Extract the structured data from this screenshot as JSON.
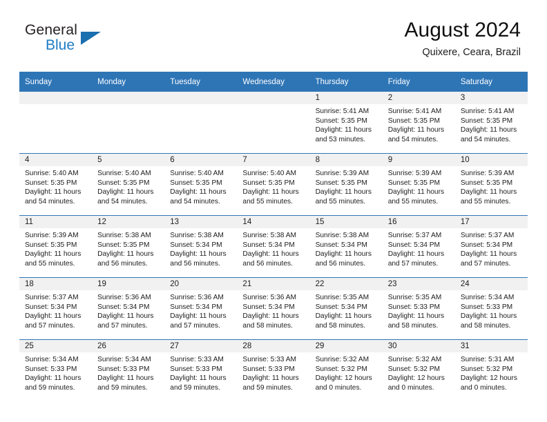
{
  "brand": {
    "name_part1": "General",
    "name_part2": "Blue"
  },
  "header": {
    "title": "August 2024",
    "subtitle": "Quixere, Ceara, Brazil"
  },
  "colors": {
    "header_blue": "#2e75b6",
    "brand_blue": "#1d7cc4",
    "daynum_band": "#f1f1f1"
  },
  "weekdays": [
    "Sunday",
    "Monday",
    "Tuesday",
    "Wednesday",
    "Thursday",
    "Friday",
    "Saturday"
  ],
  "weeks": [
    [
      {
        "day": "",
        "sunrise": "",
        "sunset": "",
        "daylight1": "",
        "daylight2": ""
      },
      {
        "day": "",
        "sunrise": "",
        "sunset": "",
        "daylight1": "",
        "daylight2": ""
      },
      {
        "day": "",
        "sunrise": "",
        "sunset": "",
        "daylight1": "",
        "daylight2": ""
      },
      {
        "day": "",
        "sunrise": "",
        "sunset": "",
        "daylight1": "",
        "daylight2": ""
      },
      {
        "day": "1",
        "sunrise": "Sunrise: 5:41 AM",
        "sunset": "Sunset: 5:35 PM",
        "daylight1": "Daylight: 11 hours",
        "daylight2": "and 53 minutes."
      },
      {
        "day": "2",
        "sunrise": "Sunrise: 5:41 AM",
        "sunset": "Sunset: 5:35 PM",
        "daylight1": "Daylight: 11 hours",
        "daylight2": "and 54 minutes."
      },
      {
        "day": "3",
        "sunrise": "Sunrise: 5:41 AM",
        "sunset": "Sunset: 5:35 PM",
        "daylight1": "Daylight: 11 hours",
        "daylight2": "and 54 minutes."
      }
    ],
    [
      {
        "day": "4",
        "sunrise": "Sunrise: 5:40 AM",
        "sunset": "Sunset: 5:35 PM",
        "daylight1": "Daylight: 11 hours",
        "daylight2": "and 54 minutes."
      },
      {
        "day": "5",
        "sunrise": "Sunrise: 5:40 AM",
        "sunset": "Sunset: 5:35 PM",
        "daylight1": "Daylight: 11 hours",
        "daylight2": "and 54 minutes."
      },
      {
        "day": "6",
        "sunrise": "Sunrise: 5:40 AM",
        "sunset": "Sunset: 5:35 PM",
        "daylight1": "Daylight: 11 hours",
        "daylight2": "and 54 minutes."
      },
      {
        "day": "7",
        "sunrise": "Sunrise: 5:40 AM",
        "sunset": "Sunset: 5:35 PM",
        "daylight1": "Daylight: 11 hours",
        "daylight2": "and 55 minutes."
      },
      {
        "day": "8",
        "sunrise": "Sunrise: 5:39 AM",
        "sunset": "Sunset: 5:35 PM",
        "daylight1": "Daylight: 11 hours",
        "daylight2": "and 55 minutes."
      },
      {
        "day": "9",
        "sunrise": "Sunrise: 5:39 AM",
        "sunset": "Sunset: 5:35 PM",
        "daylight1": "Daylight: 11 hours",
        "daylight2": "and 55 minutes."
      },
      {
        "day": "10",
        "sunrise": "Sunrise: 5:39 AM",
        "sunset": "Sunset: 5:35 PM",
        "daylight1": "Daylight: 11 hours",
        "daylight2": "and 55 minutes."
      }
    ],
    [
      {
        "day": "11",
        "sunrise": "Sunrise: 5:39 AM",
        "sunset": "Sunset: 5:35 PM",
        "daylight1": "Daylight: 11 hours",
        "daylight2": "and 55 minutes."
      },
      {
        "day": "12",
        "sunrise": "Sunrise: 5:38 AM",
        "sunset": "Sunset: 5:35 PM",
        "daylight1": "Daylight: 11 hours",
        "daylight2": "and 56 minutes."
      },
      {
        "day": "13",
        "sunrise": "Sunrise: 5:38 AM",
        "sunset": "Sunset: 5:34 PM",
        "daylight1": "Daylight: 11 hours",
        "daylight2": "and 56 minutes."
      },
      {
        "day": "14",
        "sunrise": "Sunrise: 5:38 AM",
        "sunset": "Sunset: 5:34 PM",
        "daylight1": "Daylight: 11 hours",
        "daylight2": "and 56 minutes."
      },
      {
        "day": "15",
        "sunrise": "Sunrise: 5:38 AM",
        "sunset": "Sunset: 5:34 PM",
        "daylight1": "Daylight: 11 hours",
        "daylight2": "and 56 minutes."
      },
      {
        "day": "16",
        "sunrise": "Sunrise: 5:37 AM",
        "sunset": "Sunset: 5:34 PM",
        "daylight1": "Daylight: 11 hours",
        "daylight2": "and 57 minutes."
      },
      {
        "day": "17",
        "sunrise": "Sunrise: 5:37 AM",
        "sunset": "Sunset: 5:34 PM",
        "daylight1": "Daylight: 11 hours",
        "daylight2": "and 57 minutes."
      }
    ],
    [
      {
        "day": "18",
        "sunrise": "Sunrise: 5:37 AM",
        "sunset": "Sunset: 5:34 PM",
        "daylight1": "Daylight: 11 hours",
        "daylight2": "and 57 minutes."
      },
      {
        "day": "19",
        "sunrise": "Sunrise: 5:36 AM",
        "sunset": "Sunset: 5:34 PM",
        "daylight1": "Daylight: 11 hours",
        "daylight2": "and 57 minutes."
      },
      {
        "day": "20",
        "sunrise": "Sunrise: 5:36 AM",
        "sunset": "Sunset: 5:34 PM",
        "daylight1": "Daylight: 11 hours",
        "daylight2": "and 57 minutes."
      },
      {
        "day": "21",
        "sunrise": "Sunrise: 5:36 AM",
        "sunset": "Sunset: 5:34 PM",
        "daylight1": "Daylight: 11 hours",
        "daylight2": "and 58 minutes."
      },
      {
        "day": "22",
        "sunrise": "Sunrise: 5:35 AM",
        "sunset": "Sunset: 5:34 PM",
        "daylight1": "Daylight: 11 hours",
        "daylight2": "and 58 minutes."
      },
      {
        "day": "23",
        "sunrise": "Sunrise: 5:35 AM",
        "sunset": "Sunset: 5:33 PM",
        "daylight1": "Daylight: 11 hours",
        "daylight2": "and 58 minutes."
      },
      {
        "day": "24",
        "sunrise": "Sunrise: 5:34 AM",
        "sunset": "Sunset: 5:33 PM",
        "daylight1": "Daylight: 11 hours",
        "daylight2": "and 58 minutes."
      }
    ],
    [
      {
        "day": "25",
        "sunrise": "Sunrise: 5:34 AM",
        "sunset": "Sunset: 5:33 PM",
        "daylight1": "Daylight: 11 hours",
        "daylight2": "and 59 minutes."
      },
      {
        "day": "26",
        "sunrise": "Sunrise: 5:34 AM",
        "sunset": "Sunset: 5:33 PM",
        "daylight1": "Daylight: 11 hours",
        "daylight2": "and 59 minutes."
      },
      {
        "day": "27",
        "sunrise": "Sunrise: 5:33 AM",
        "sunset": "Sunset: 5:33 PM",
        "daylight1": "Daylight: 11 hours",
        "daylight2": "and 59 minutes."
      },
      {
        "day": "28",
        "sunrise": "Sunrise: 5:33 AM",
        "sunset": "Sunset: 5:33 PM",
        "daylight1": "Daylight: 11 hours",
        "daylight2": "and 59 minutes."
      },
      {
        "day": "29",
        "sunrise": "Sunrise: 5:32 AM",
        "sunset": "Sunset: 5:32 PM",
        "daylight1": "Daylight: 12 hours",
        "daylight2": "and 0 minutes."
      },
      {
        "day": "30",
        "sunrise": "Sunrise: 5:32 AM",
        "sunset": "Sunset: 5:32 PM",
        "daylight1": "Daylight: 12 hours",
        "daylight2": "and 0 minutes."
      },
      {
        "day": "31",
        "sunrise": "Sunrise: 5:31 AM",
        "sunset": "Sunset: 5:32 PM",
        "daylight1": "Daylight: 12 hours",
        "daylight2": "and 0 minutes."
      }
    ]
  ]
}
